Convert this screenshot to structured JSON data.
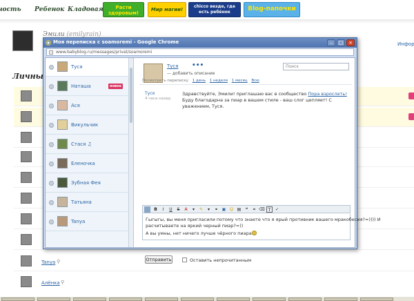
{
  "site": {
    "nav": [
      "ность",
      "Ребенок",
      "Кладовая"
    ],
    "banners": [
      "Расти здоровым!",
      "Мир магии!",
      "chicco везде, где есть ребёнок",
      "Blog-папочки"
    ],
    "profile": {
      "name": "Эмили",
      "nick": "(emilyrain)"
    },
    "info_link": "Информ",
    "section_title": "Личные",
    "bg_users": [
      "Tanya",
      "Алёнка"
    ]
  },
  "window": {
    "title": "Моя переписка с soamoremi - Google Chrome",
    "url": "www.babyblog.ru/messages/privat/soamoremi",
    "btn_min": "–",
    "btn_max": "□",
    "btn_close": "×"
  },
  "contacts": [
    {
      "name": "Туся",
      "active": true,
      "badge": ""
    },
    {
      "name": "Наташа",
      "active": false,
      "badge": "новое"
    },
    {
      "name": "Ася",
      "active": false,
      "badge": ""
    },
    {
      "name": "Викульчик",
      "active": false,
      "badge": ""
    },
    {
      "name": "Стася ♫",
      "active": false,
      "badge": ""
    },
    {
      "name": "Еленочка",
      "active": false,
      "badge": ""
    },
    {
      "name": "Зубная Фея",
      "active": false,
      "badge": ""
    },
    {
      "name": "Татьяна",
      "active": false,
      "badge": ""
    },
    {
      "name": "Tanya",
      "active": false,
      "badge": ""
    }
  ],
  "conversation": {
    "name": "Туся",
    "dots": "•••",
    "add_description": "— добавить описание",
    "search_placeholder": "Поиск",
    "period_label": "Посмотреть переписку",
    "periods": [
      "1 день",
      "1 неделя",
      "1 месяц",
      "Всю"
    ],
    "message": {
      "author": "Туся",
      "time": "4 часа назад",
      "text_before": "Здравствуйте, Эмили! приглашаю вас в сообщество ",
      "link": "Пора взрослеть!",
      "text_after": " Буду благодарна за пиар в вашем стиле - ваш слог цепляет! С уважением, Туся."
    },
    "draft_lines": [
      "Гыгыгы, вы меня пригласили потому что знаете что я ярый противник вашего мракобесия?=)))) И",
      "расчитываете на яркий черный пиар?=))",
      "А вы умны, нет ничего лучше чёрного пиара"
    ],
    "send_label": "Отправить",
    "unread_label": "Оставить непрочитанным"
  }
}
